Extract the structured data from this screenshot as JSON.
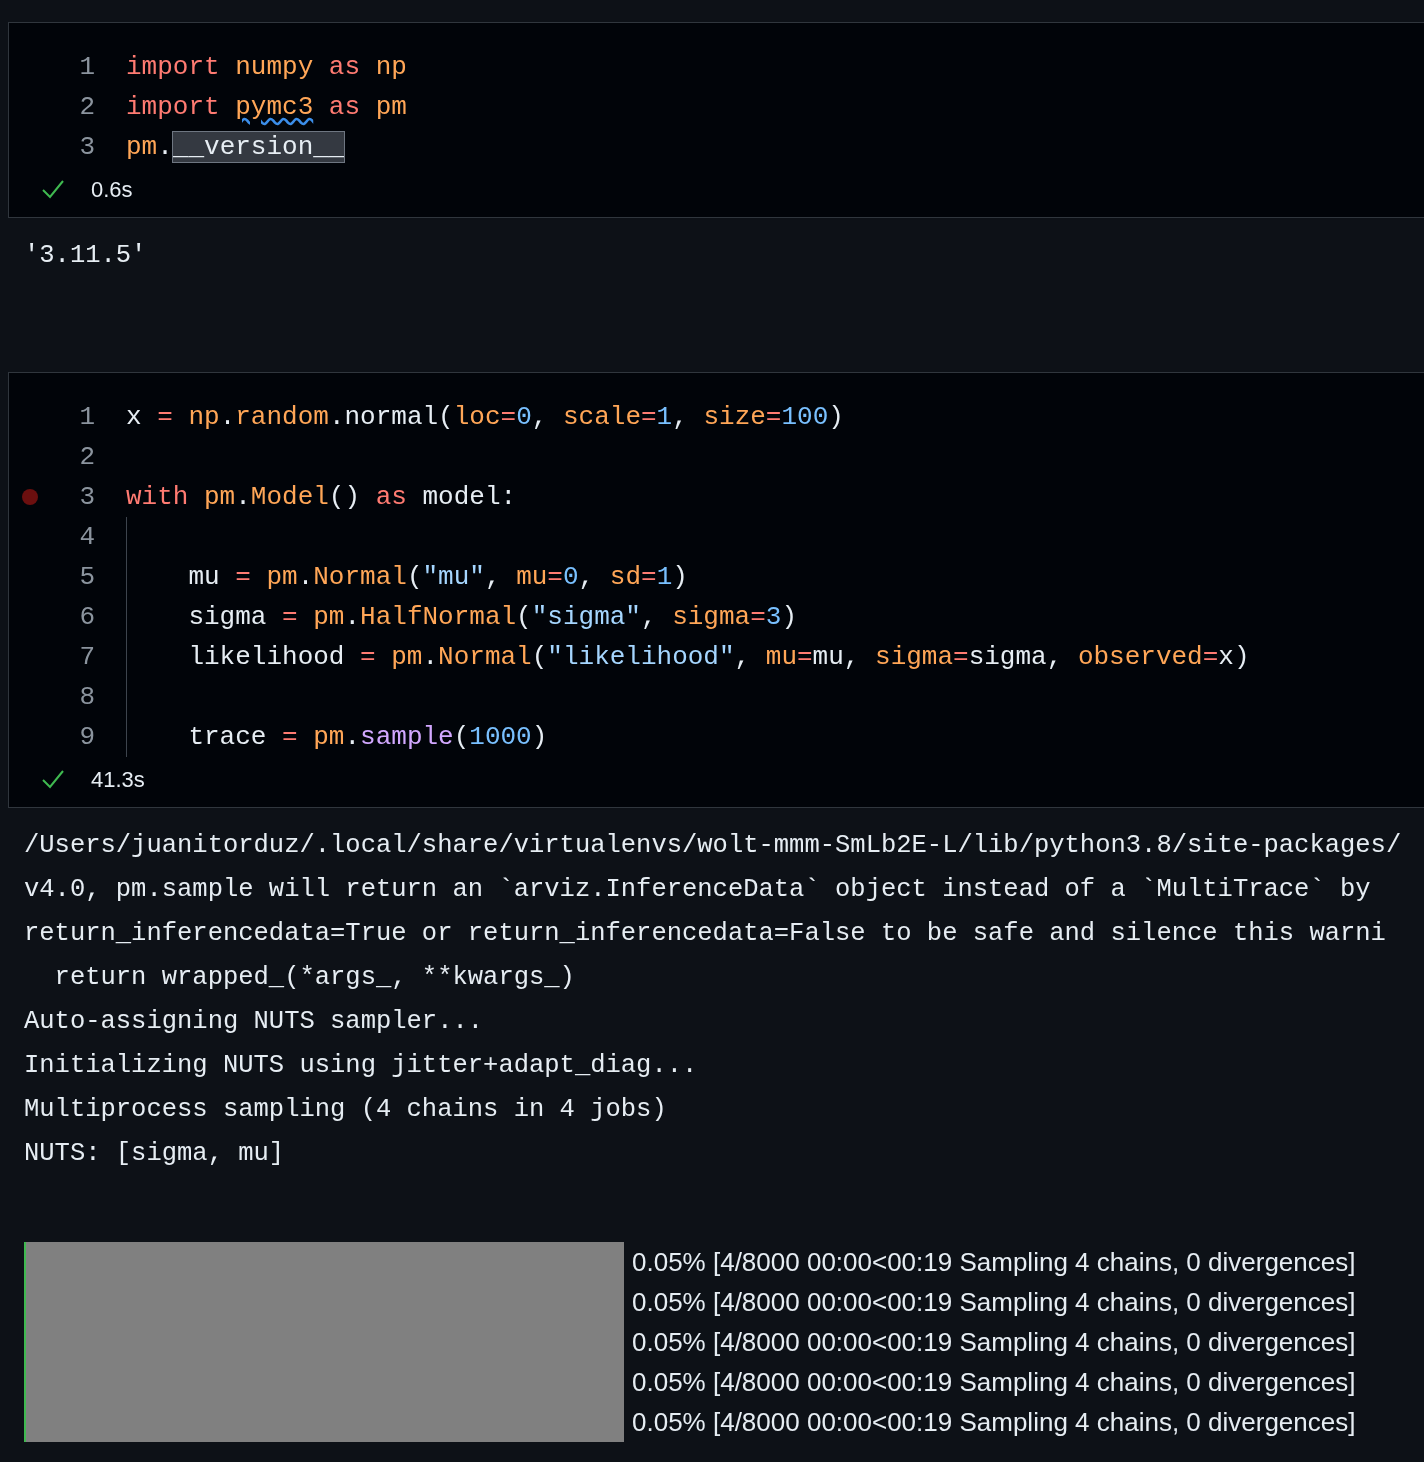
{
  "cells": [
    {
      "lines": [
        {
          "number": "1",
          "breakpoint": false,
          "tokens": [
            {
              "kind": "keyword",
              "text": "import "
            },
            {
              "kind": "module",
              "text": "numpy "
            },
            {
              "kind": "keyword",
              "text": "as "
            },
            {
              "kind": "module",
              "text": "np"
            }
          ]
        },
        {
          "number": "2",
          "breakpoint": false,
          "tokens": [
            {
              "kind": "keyword",
              "text": "import "
            },
            {
              "kind": "warned",
              "text": "pymc3"
            },
            {
              "kind": "keyword",
              "text": " as "
            },
            {
              "kind": "module",
              "text": "pm"
            }
          ]
        },
        {
          "number": "3",
          "breakpoint": false,
          "tokens": [
            {
              "kind": "module",
              "text": "pm"
            },
            {
              "kind": "plain",
              "text": "."
            },
            {
              "kind": "highlight",
              "text": "__version__"
            }
          ]
        }
      ],
      "status": {
        "ok": true,
        "time": "0.6s"
      },
      "output": {
        "kind": "plain",
        "lines": [
          "'3.11.5'"
        ]
      }
    },
    {
      "lines": [
        {
          "number": "1",
          "breakpoint": false,
          "tokens": [
            {
              "kind": "plain",
              "text": "x "
            },
            {
              "kind": "operator",
              "text": "= "
            },
            {
              "kind": "module",
              "text": "np"
            },
            {
              "kind": "plain",
              "text": "."
            },
            {
              "kind": "module",
              "text": "random"
            },
            {
              "kind": "plain",
              "text": ".normal("
            },
            {
              "kind": "param",
              "text": "loc"
            },
            {
              "kind": "operator",
              "text": "="
            },
            {
              "kind": "number",
              "text": "0"
            },
            {
              "kind": "plain",
              "text": ", "
            },
            {
              "kind": "param",
              "text": "scale"
            },
            {
              "kind": "operator",
              "text": "="
            },
            {
              "kind": "number",
              "text": "1"
            },
            {
              "kind": "plain",
              "text": ", "
            },
            {
              "kind": "param",
              "text": "size"
            },
            {
              "kind": "operator",
              "text": "="
            },
            {
              "kind": "number",
              "text": "100"
            },
            {
              "kind": "plain",
              "text": ")"
            }
          ]
        },
        {
          "number": "2",
          "breakpoint": false
        },
        {
          "number": "3",
          "breakpoint": true,
          "tokens": [
            {
              "kind": "keyword",
              "text": "with "
            },
            {
              "kind": "module",
              "text": "pm"
            },
            {
              "kind": "plain",
              "text": "."
            },
            {
              "kind": "module",
              "text": "Model"
            },
            {
              "kind": "plain",
              "text": "() "
            },
            {
              "kind": "keyword",
              "text": "as"
            },
            {
              "kind": "plain",
              "text": " model:"
            }
          ]
        },
        {
          "number": "4",
          "breakpoint": false
        },
        {
          "number": "5",
          "breakpoint": false,
          "tokens": [
            {
              "kind": "plain",
              "text": "    mu "
            },
            {
              "kind": "operator",
              "text": "= "
            },
            {
              "kind": "module",
              "text": "pm"
            },
            {
              "kind": "plain",
              "text": "."
            },
            {
              "kind": "module",
              "text": "Normal"
            },
            {
              "kind": "plain",
              "text": "("
            },
            {
              "kind": "string",
              "text": "\"mu\""
            },
            {
              "kind": "plain",
              "text": ", "
            },
            {
              "kind": "param",
              "text": "mu"
            },
            {
              "kind": "operator",
              "text": "="
            },
            {
              "kind": "number",
              "text": "0"
            },
            {
              "kind": "plain",
              "text": ", "
            },
            {
              "kind": "param",
              "text": "sd"
            },
            {
              "kind": "operator",
              "text": "="
            },
            {
              "kind": "number",
              "text": "1"
            },
            {
              "kind": "plain",
              "text": ")"
            }
          ]
        },
        {
          "number": "6",
          "breakpoint": false,
          "tokens": [
            {
              "kind": "plain",
              "text": "    sigma "
            },
            {
              "kind": "operator",
              "text": "= "
            },
            {
              "kind": "module",
              "text": "pm"
            },
            {
              "kind": "plain",
              "text": "."
            },
            {
              "kind": "module",
              "text": "HalfNormal"
            },
            {
              "kind": "plain",
              "text": "("
            },
            {
              "kind": "string",
              "text": "\"sigma\""
            },
            {
              "kind": "plain",
              "text": ", "
            },
            {
              "kind": "param",
              "text": "sigma"
            },
            {
              "kind": "operator",
              "text": "="
            },
            {
              "kind": "number",
              "text": "3"
            },
            {
              "kind": "plain",
              "text": ")"
            }
          ]
        },
        {
          "number": "7",
          "breakpoint": false,
          "tokens": [
            {
              "kind": "plain",
              "text": "    likelihood "
            },
            {
              "kind": "operator",
              "text": "= "
            },
            {
              "kind": "module",
              "text": "pm"
            },
            {
              "kind": "plain",
              "text": "."
            },
            {
              "kind": "module",
              "text": "Normal"
            },
            {
              "kind": "plain",
              "text": "("
            },
            {
              "kind": "string",
              "text": "\"likelihood\""
            },
            {
              "kind": "plain",
              "text": ", "
            },
            {
              "kind": "param",
              "text": "mu"
            },
            {
              "kind": "operator",
              "text": "="
            },
            {
              "kind": "plain",
              "text": "mu, "
            },
            {
              "kind": "param",
              "text": "sigma"
            },
            {
              "kind": "operator",
              "text": "="
            },
            {
              "kind": "plain",
              "text": "sigma, "
            },
            {
              "kind": "param",
              "text": "observed"
            },
            {
              "kind": "operator",
              "text": "="
            },
            {
              "kind": "plain",
              "text": "x)"
            }
          ]
        },
        {
          "number": "8",
          "breakpoint": false
        },
        {
          "number": "9",
          "breakpoint": false,
          "tokens": [
            {
              "kind": "plain",
              "text": "    trace "
            },
            {
              "kind": "operator",
              "text": "= "
            },
            {
              "kind": "module",
              "text": "pm"
            },
            {
              "kind": "plain",
              "text": "."
            },
            {
              "kind": "method",
              "text": "sample"
            },
            {
              "kind": "plain",
              "text": "("
            },
            {
              "kind": "number",
              "text": "1000"
            },
            {
              "kind": "plain",
              "text": ")"
            }
          ]
        }
      ],
      "status": {
        "ok": true,
        "time": "41.3s"
      },
      "output": {
        "kind": "log",
        "lines": [
          "/Users/juanitorduz/.local/share/virtualenvs/wolt-mmm-SmLb2E-L/lib/python3.8/site-packages/",
          "v4.0, pm.sample will return an `arviz.InferenceData` object instead of a `MultiTrace` by",
          "return_inferencedata=True or return_inferencedata=False to be safe and silence this warni",
          "  return wrapped_(*args_, **kwargs_)",
          "Auto-assigning NUTS sampler...",
          "Initializing NUTS using jitter+adapt_diag...",
          "Multiprocess sampling (4 chains in 4 jobs)",
          "NUTS: [sigma, mu]"
        ],
        "progress": [
          {
            "level": 0.0005,
            "text": "0.05% [4/8000 00:00<00:19 Sampling 4 chains, 0 divergences]"
          },
          {
            "level": 0.0005,
            "text": "0.05% [4/8000 00:00<00:19 Sampling 4 chains, 0 divergences]"
          },
          {
            "level": 0.0005,
            "text": "0.05% [4/8000 00:00<00:19 Sampling 4 chains, 0 divergences]"
          },
          {
            "level": 0.0005,
            "text": "0.05% [4/8000 00:00<00:19 Sampling 4 chains, 0 divergences]"
          },
          {
            "level": 0.0005,
            "text": "0.05% [4/8000 00:00<00:19 Sampling 4 chains, 0 divergences]"
          }
        ]
      }
    }
  ]
}
